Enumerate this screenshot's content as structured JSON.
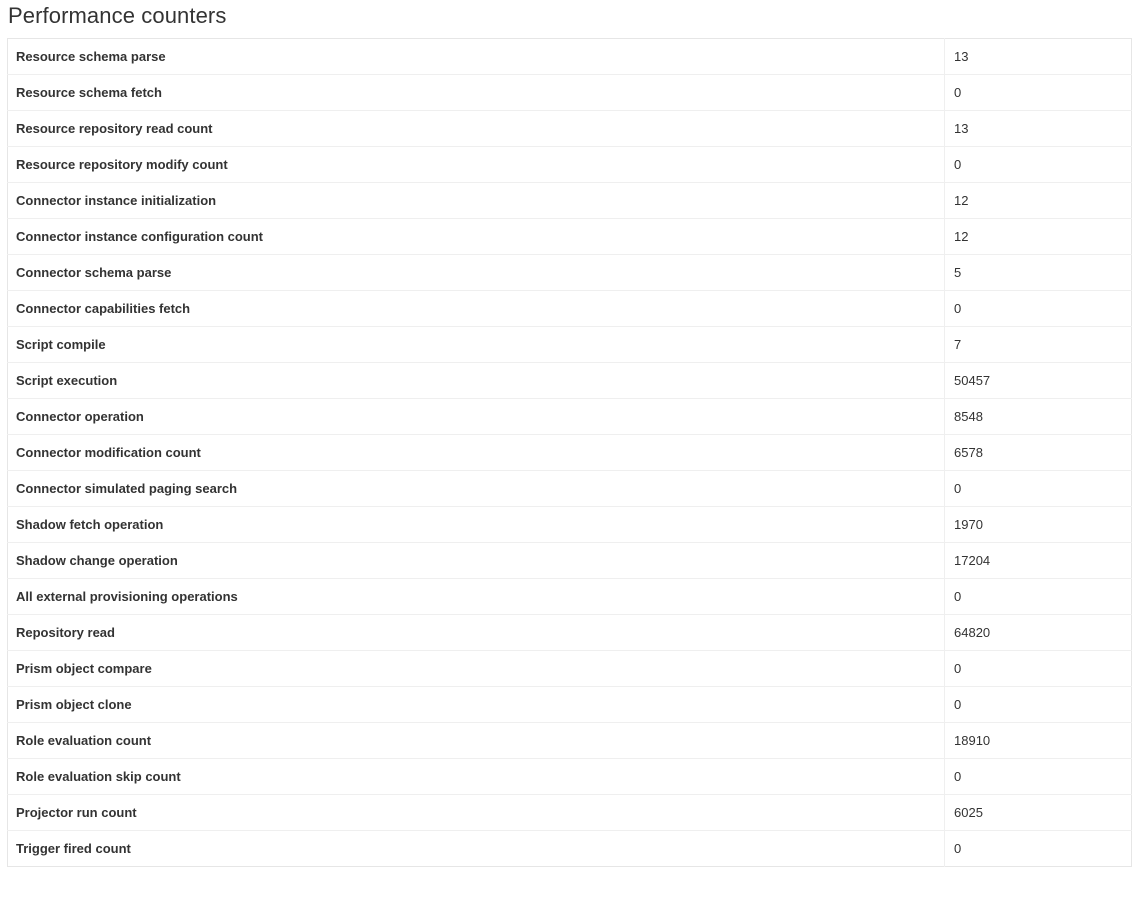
{
  "page": {
    "title": "Performance counters"
  },
  "counters": [
    {
      "label": "Resource schema parse",
      "value": "13"
    },
    {
      "label": "Resource schema fetch",
      "value": "0"
    },
    {
      "label": "Resource repository read count",
      "value": "13"
    },
    {
      "label": "Resource repository modify count",
      "value": "0"
    },
    {
      "label": "Connector instance initialization",
      "value": "12"
    },
    {
      "label": "Connector instance configuration count",
      "value": "12"
    },
    {
      "label": "Connector schema parse",
      "value": "5"
    },
    {
      "label": "Connector capabilities fetch",
      "value": "0"
    },
    {
      "label": "Script compile",
      "value": "7"
    },
    {
      "label": "Script execution",
      "value": "50457"
    },
    {
      "label": "Connector operation",
      "value": "8548"
    },
    {
      "label": "Connector modification count",
      "value": "6578"
    },
    {
      "label": "Connector simulated paging search",
      "value": "0"
    },
    {
      "label": "Shadow fetch operation",
      "value": "1970"
    },
    {
      "label": "Shadow change operation",
      "value": "17204"
    },
    {
      "label": "All external provisioning operations",
      "value": "0"
    },
    {
      "label": "Repository read",
      "value": "64820"
    },
    {
      "label": "Prism object compare",
      "value": "0"
    },
    {
      "label": "Prism object clone",
      "value": "0"
    },
    {
      "label": "Role evaluation count",
      "value": "18910"
    },
    {
      "label": "Role evaluation skip count",
      "value": "0"
    },
    {
      "label": "Projector run count",
      "value": "6025"
    },
    {
      "label": "Trigger fired count",
      "value": "0"
    }
  ]
}
